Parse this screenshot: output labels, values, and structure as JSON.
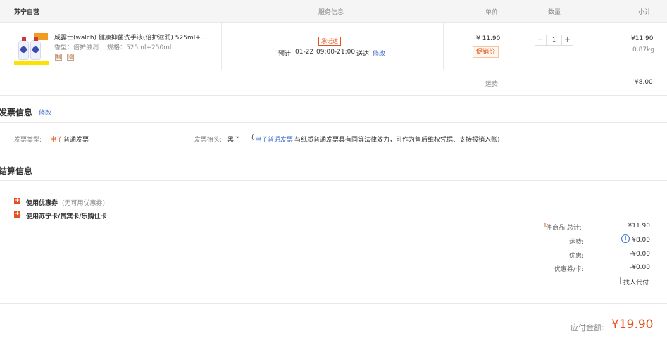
{
  "header": {
    "store": "苏宁自营",
    "service": "服务信息",
    "unit_price": "单价",
    "quantity": "数量",
    "subtotal": "小计"
  },
  "product": {
    "title": "威露士(walch) 健康抑菌洗手液(倍护滋润) 525ml+...",
    "spec_fragrance": "香型：倍护滋润",
    "spec_size": "规格：525ml+250ml",
    "icon_a": "制",
    "icon_b": "退",
    "service_badge": "承诺达",
    "eta_prefix": "预计",
    "eta_date": "01-22",
    "eta_time": "09:00-21:00",
    "eta_suffix": "送达",
    "eta_edit": "修改",
    "price": "¥ 11.90",
    "promo_label": "促销价",
    "qty": "1",
    "subtotal": "¥11.90",
    "weight": "0.87kg",
    "thumb_icon": "hand-soap-product-image"
  },
  "shipping": {
    "label": "运费",
    "value": "¥8.00"
  },
  "invoice": {
    "title": "发票信息",
    "edit": "修改",
    "type_label": "发票类型:",
    "type_value_highlight": "电子",
    "type_value_rest": "普通发票",
    "head_label": "发票抬头:",
    "head_value": "黑子",
    "note_open": "(",
    "note_link": "电子普通发票",
    "note_rest": "与纸质普通发票具有同等法律效力，可作为售后维权凭据、支持报销入账)"
  },
  "settlement": {
    "title": "结算信息",
    "coupon_label": "使用优惠券",
    "coupon_note": "(无可用优惠券)",
    "card_label": "使用苏宁卡/贵宾卡/乐购仕卡",
    "count": "1",
    "count_label": "件商品 总计:",
    "total": "¥11.90",
    "freight_label": "运费:",
    "freight": "¥8.00",
    "discount_label": "优惠:",
    "discount": "-¥0.00",
    "voucher_label": "优惠券/卡:",
    "voucher": "-¥0.00",
    "proxy_pay": "找人代付"
  },
  "payable": {
    "label": "应付金额:",
    "value": "¥19.90"
  },
  "colors": {
    "accent": "#e5511d",
    "link": "#3d70c8"
  },
  "icons": {
    "plus": "+",
    "minus": "−",
    "info": "i"
  }
}
